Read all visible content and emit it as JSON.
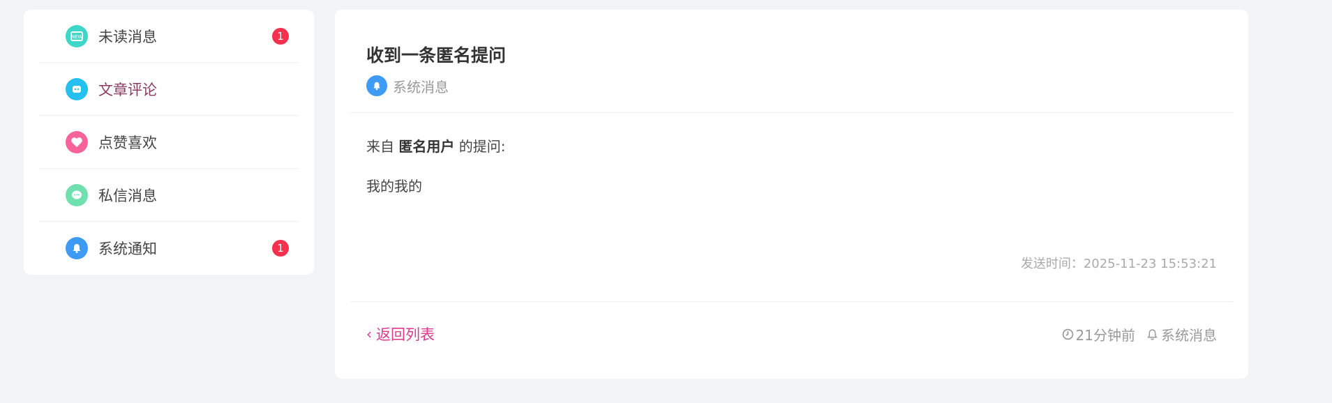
{
  "sidebar": {
    "items": [
      {
        "label": "未读消息",
        "icon": "unread-icon",
        "color": "#3ed6c8",
        "badge": "1"
      },
      {
        "label": "文章评论",
        "icon": "comment-icon",
        "color": "#26c0f0",
        "badge": ""
      },
      {
        "label": "点赞喜欢",
        "icon": "heart-icon",
        "color": "#f7649c",
        "badge": ""
      },
      {
        "label": "私信消息",
        "icon": "chat-icon",
        "color": "#6fe0ae",
        "badge": ""
      },
      {
        "label": "系统通知",
        "icon": "bell-icon",
        "color": "#3d9af5",
        "badge": "1"
      }
    ]
  },
  "message": {
    "title": "收到一条匿名提问",
    "category": "系统消息",
    "from_prefix": "来自",
    "from_user": "匿名用户",
    "from_suffix": "的提问:",
    "question": "我的我的",
    "send_time": "发送时间：2025-11-23 15:53:21"
  },
  "footer": {
    "back_label": "返回列表",
    "relative_time": "21分钟前",
    "category": "系统消息"
  },
  "colors": {
    "accent": "#e0388f",
    "badge": "#f5324e",
    "active_label": "#8b3a62"
  }
}
